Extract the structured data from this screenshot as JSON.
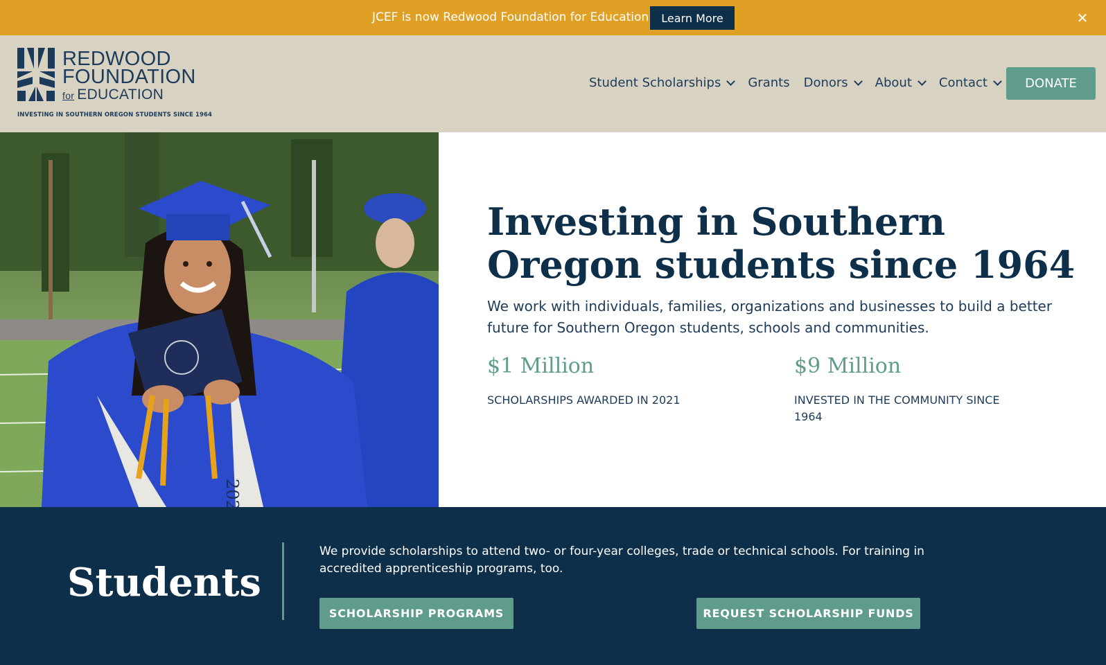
{
  "announcement": {
    "text": "JCEF is now Redwood Foundation for Education",
    "button_label": "Learn More",
    "close_label": "✕"
  },
  "logo": {
    "line1": "REDWOOD",
    "line2": "FOUNDATION",
    "for": "for",
    "line3": "EDUCATION",
    "tagline": "INVESTING IN SOUTHERN OREGON STUDENTS SINCE 1964"
  },
  "nav": {
    "items": [
      {
        "label": "Student Scholarships",
        "has_dropdown": true
      },
      {
        "label": "Grants",
        "has_dropdown": false
      },
      {
        "label": "Donors",
        "has_dropdown": true
      },
      {
        "label": "About",
        "has_dropdown": true
      },
      {
        "label": "Contact",
        "has_dropdown": true
      }
    ],
    "donate_label": "DONATE"
  },
  "hero": {
    "title": "Investing in Southern Oregon students since 1964",
    "subtitle": "We work with individuals, families, organizations and businesses to build a better future for Southern Oregon students, schools and communities.",
    "stats": [
      {
        "value": "$1 Million",
        "label": "SCHOLARSHIPS AWARDED IN 2021"
      },
      {
        "value": "$9 Million",
        "label": "INVESTED IN THE COMMUNITY SINCE 1964"
      }
    ],
    "image_alt": "graduate-photo",
    "gown_text": "202"
  },
  "students": {
    "title": "Students",
    "text": "We provide scholarships to attend two- or four-year colleges, trade or technical schools. For training in accredited apprenticeship programs, too.",
    "buttons": [
      "SCHOLARSHIP PROGRAMS",
      "REQUEST SCHOLARSHIP FUNDS"
    ]
  },
  "colors": {
    "announcement_bg": "#e0a025",
    "header_bg": "#d8d2c2",
    "navy": "#0e2f4a",
    "teal": "#5f9c8c"
  }
}
